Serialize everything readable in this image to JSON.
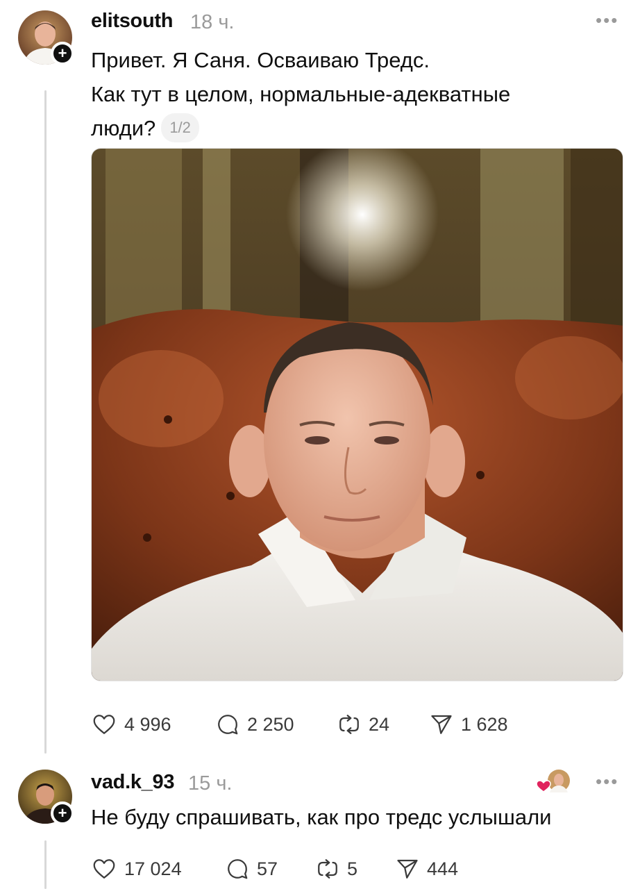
{
  "post": {
    "username": "elitsouth",
    "time": "18 ч.",
    "text_lines": [
      "Привет. Я Саня. Осваиваю Тредс.",
      "Как тут в целом, нормальные-адекватные",
      "люди?"
    ],
    "counter": "1/2",
    "likes": "4 996",
    "replies": "2 250",
    "reposts": "24",
    "shares": "1 628"
  },
  "reply": {
    "username": "vad.k_93",
    "time": "15 ч.",
    "text": "Не буду спрашивать, как про тредс услышали",
    "likes": "17 024",
    "replies": "57",
    "reposts": "5",
    "shares": "444"
  },
  "icons": {
    "more": "more-icon",
    "like": "heart-icon",
    "reply": "comment-icon",
    "repost": "repost-icon",
    "share": "send-icon",
    "follow": "plus-icon"
  },
  "colors": {
    "text": "#101010",
    "muted": "#9a9a9a",
    "liked_heart": "#e0245e"
  }
}
